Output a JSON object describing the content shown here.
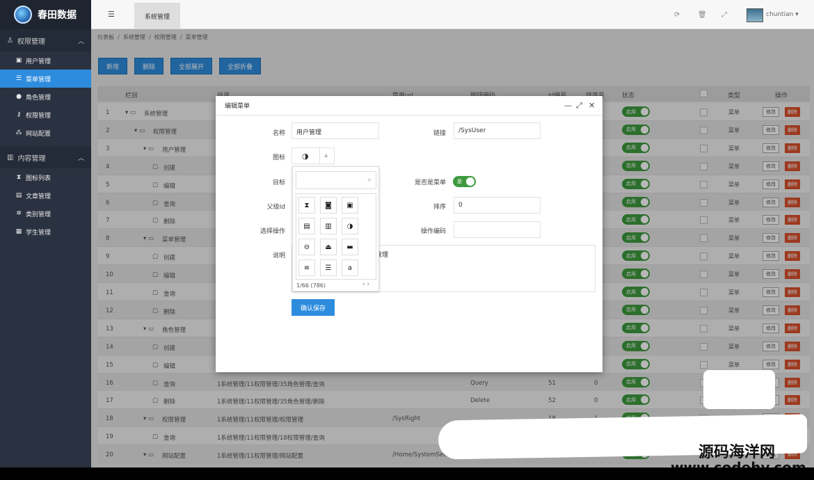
{
  "app": {
    "title": "春田数据"
  },
  "sidebar": {
    "groups": [
      {
        "label": "权限管理",
        "items": [
          "用户管理",
          "菜单管理",
          "角色管理",
          "权限管理",
          "网站配置"
        ]
      },
      {
        "label": "内容管理",
        "items": [
          "图标列表",
          "文章管理",
          "类别管理",
          "学生管理"
        ]
      }
    ],
    "active_item": "菜单管理"
  },
  "topbar": {
    "tab": "系统管理",
    "menu_icon": "hamburger-icon",
    "user": "chuntian"
  },
  "breadcrumb": [
    "仪表板",
    "系统管理",
    "权限管理",
    "菜单管理"
  ],
  "toolbar": {
    "add": "新增",
    "delete": "删除",
    "expand_all": "全部展开",
    "collapse_all": "全部折叠"
  },
  "table": {
    "headers": [
      "栏目",
      "目录",
      "菜单url",
      "按钮编码",
      "Id编号",
      "排序号",
      "状态",
      "类型",
      "操作"
    ],
    "rows": [
      {
        "n": "1",
        "name": "系统管理",
        "path": "",
        "url": "",
        "code": "",
        "id": "",
        "sort": ""
      },
      {
        "n": "2",
        "name": "权限管理",
        "path": "",
        "url": "",
        "code": "",
        "id": "",
        "sort": ""
      },
      {
        "n": "3",
        "name": "用户管理",
        "path": "",
        "url": "",
        "code": "",
        "id": "",
        "sort": ""
      },
      {
        "n": "4",
        "name": "创建",
        "path": "",
        "url": "",
        "code": "",
        "id": "",
        "sort": ""
      },
      {
        "n": "5",
        "name": "编辑",
        "path": "",
        "url": "",
        "code": "",
        "id": "",
        "sort": ""
      },
      {
        "n": "6",
        "name": "查询",
        "path": "",
        "url": "",
        "code": "",
        "id": "",
        "sort": ""
      },
      {
        "n": "7",
        "name": "删除",
        "path": "",
        "url": "",
        "code": "",
        "id": "",
        "sort": ""
      },
      {
        "n": "8",
        "name": "菜单管理",
        "path": "",
        "url": "",
        "code": "",
        "id": "",
        "sort": ""
      },
      {
        "n": "9",
        "name": "创建",
        "path": "",
        "url": "",
        "code": "",
        "id": "",
        "sort": ""
      },
      {
        "n": "10",
        "name": "编辑",
        "path": "",
        "url": "",
        "code": "",
        "id": "",
        "sort": ""
      },
      {
        "n": "11",
        "name": "查询",
        "path": "",
        "url": "",
        "code": "",
        "id": "",
        "sort": ""
      },
      {
        "n": "12",
        "name": "删除",
        "path": "",
        "url": "",
        "code": "",
        "id": "",
        "sort": ""
      },
      {
        "n": "13",
        "name": "角色管理",
        "path": "",
        "url": "",
        "code": "",
        "id": "",
        "sort": ""
      },
      {
        "n": "14",
        "name": "创建",
        "path": "",
        "url": "",
        "code": "",
        "id": "",
        "sort": ""
      },
      {
        "n": "15",
        "name": "编辑",
        "path": "",
        "url": "",
        "code": "",
        "id": "",
        "sort": ""
      },
      {
        "n": "16",
        "name": "查询",
        "path": "1系统管理/11权限管理/35角色管理/查询",
        "url": "",
        "code": "Query",
        "id": "51",
        "sort": "0"
      },
      {
        "n": "17",
        "name": "删除",
        "path": "1系统管理/11权限管理/35角色管理/删除",
        "url": "",
        "code": "Delete",
        "id": "52",
        "sort": "0"
      },
      {
        "n": "18",
        "name": "权限管理",
        "path": "1系统管理/11权限管理/权限管理",
        "url": "/SysRight",
        "code": "",
        "id": "18",
        "sort": "1"
      },
      {
        "n": "19",
        "name": "查询",
        "path": "1系统管理/11权限管理/18权限管理/查询",
        "url": "",
        "code": "",
        "id": "",
        "sort": ""
      },
      {
        "n": "20",
        "name": "网站配置",
        "path": "1系统管理/11权限管理/网站配置",
        "url": "/Home/SystemSetting",
        "code": "",
        "id": "",
        "sort": "1"
      }
    ],
    "status_label": "启用",
    "type_label": "菜单",
    "edit_label": "修改",
    "delete_label": "删除"
  },
  "modal": {
    "title": "编辑菜单",
    "name_label": "名称",
    "name_value": "用户管理",
    "link_label": "链接",
    "link_value": "/SysUser",
    "icon_label": "图标",
    "target_label": "目标",
    "is_menu_label": "是否是菜单",
    "is_menu_value": "是",
    "parent_label": "父级Id",
    "sort_label": "排序",
    "sort_value": "0",
    "action_label": "选择操作",
    "action_code_label": "操作编码",
    "desc_label": "说明",
    "desc_value": "管理",
    "save": "确认保存",
    "picker_pager": "1/66 (786)"
  },
  "watermark": {
    "line1": "源码海洋网",
    "line2": "www.codehy.com"
  }
}
